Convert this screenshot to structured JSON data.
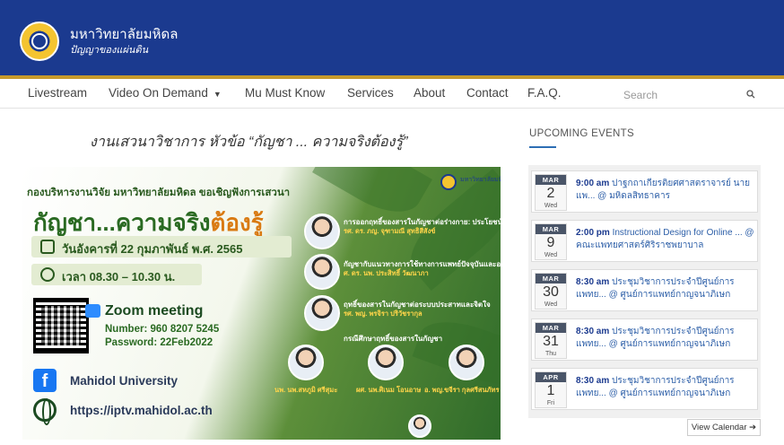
{
  "header": {
    "title": "มหาวิทยาลัยมหิดล",
    "subtitle": "ปัญญาของแผ่นดิน"
  },
  "nav": {
    "items": [
      "Livestream",
      "Video On Demand",
      "Mu Must Know",
      "Services",
      "About",
      "Contact",
      "F.A.Q."
    ],
    "search_placeholder": "Search"
  },
  "main": {
    "title": "งานเสวนาวิชาการ หัวข้อ “กัญชา ... ความจริงต้องรู้”"
  },
  "poster": {
    "org_line": "กองบริหารงานวิจัย มหาวิทยาลัยมหิดล ขอเชิญฟังการเสวนา",
    "headline_a": "กัญชา...ความจริง",
    "headline_b": "ต้องรู้",
    "date": "วันอังคารที่ 22 กุมภาพันธ์ พ.ศ. 2565",
    "time": "เวลา 08.30 – 10.30 น.",
    "zoom_title": "Zoom meeting",
    "zoom_number": "Number: 960 8207 5245",
    "zoom_password": "Password: 22Feb2022",
    "facebook": "Mahidol University",
    "website": "https://iptv.mahidol.ac.th",
    "seal_text": "มหาวิทยาลัยมหิดล",
    "speakers": [
      {
        "topic": "การออกฤทธิ์ของสารในกัญชาต่อร่างกาย: ประโยชน์และโทษ",
        "name": "รศ. ดร. ภญ. จุฑามณี สุทธิสีสังข์"
      },
      {
        "topic": "กัญชากับแนวทางการใช้ทางการแพทย์ปัจจุบันและอนาคต",
        "name": "ศ. ดร. นพ. ประสิทธิ์ วัฒนาภา"
      },
      {
        "topic": "ฤทธิ์ของสารในกัญชาต่อระบบประสาทและจิตใจ",
        "name": "รศ. พญ. พรจิรา ปริวัชรากุล"
      },
      {
        "topic": "กรณีศึกษาฤทธิ์ของสารในกัญชา",
        "name": ""
      }
    ],
    "case_speakers": [
      "นพ. นพ.สหภูมิ ศรีสุมะ",
      "ผศ. นพ.ศิเนม โอนอาษ",
      "อ. พญ.ขจีรา กุลศรีสนภัทร"
    ]
  },
  "sidebar": {
    "heading": "UPCOMING EVENTS",
    "events": [
      {
        "month": "MAR",
        "day": "2",
        "weekday": "Wed",
        "time": "9:00 am",
        "text": "ปาฐกถาเกียรติยศศาสตราจารย์ นายแพ... @ มหิดลสิทธาคาร"
      },
      {
        "month": "MAR",
        "day": "9",
        "weekday": "Wed",
        "time": "2:00 pm",
        "text": "Instructional Design for Online ... @ คณะแพทยศาสตร์ศิริราชพยาบาล"
      },
      {
        "month": "MAR",
        "day": "30",
        "weekday": "Wed",
        "time": "8:30 am",
        "text": "ประชุมวิชาการประจำปีศูนย์การแพทย... @ ศูนย์การแพทย์กาญจนาภิเษก"
      },
      {
        "month": "MAR",
        "day": "31",
        "weekday": "Thu",
        "time": "8:30 am",
        "text": "ประชุมวิชาการประจำปีศูนย์การแพทย... @ ศูนย์การแพทย์กาญจนาภิเษก"
      },
      {
        "month": "APR",
        "day": "1",
        "weekday": "Fri",
        "time": "8:30 am",
        "text": "ประชุมวิชาการประจำปีศูนย์การแพทย... @ ศูนย์การแพทย์กาญจนาภิเษก"
      }
    ],
    "view_calendar": "View Calendar ➔"
  }
}
